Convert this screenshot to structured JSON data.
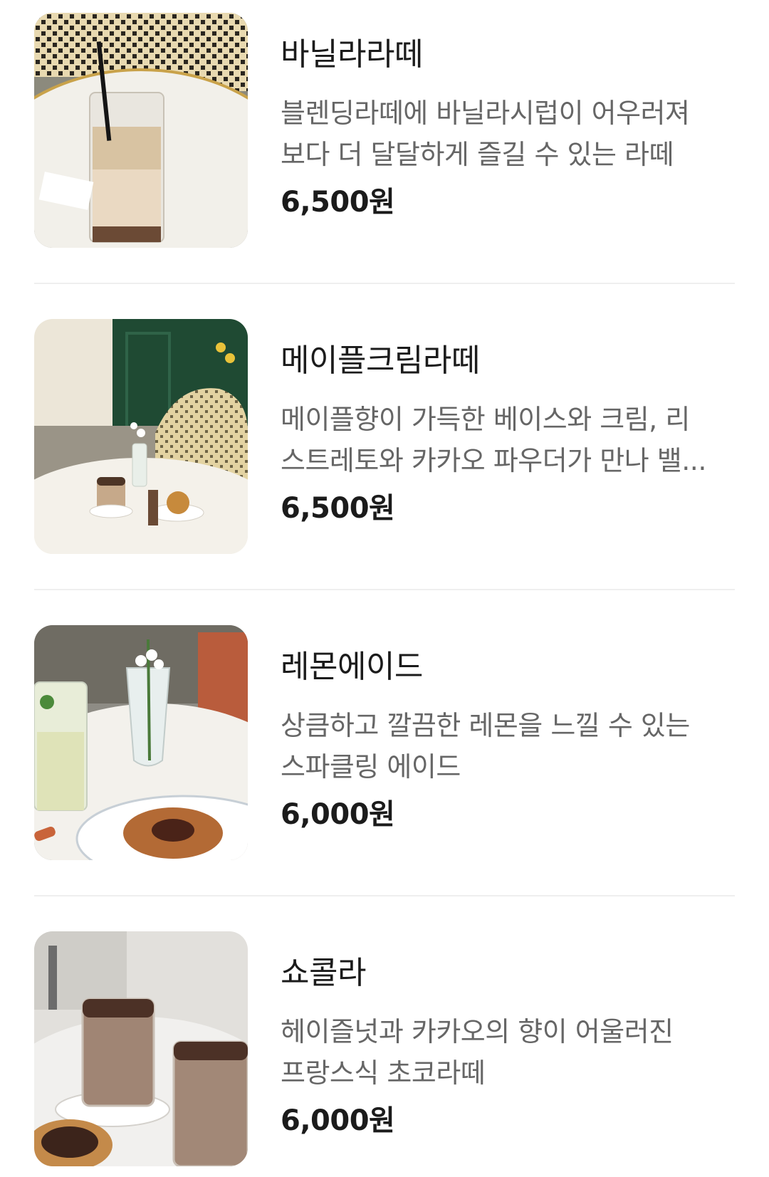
{
  "menu": {
    "items": [
      {
        "name": "바닐라라떼",
        "description_lines": [
          "블렌딩라떼에 바닐라시럽이 어우러져",
          "보다 더 달달하게 즐길 수 있는 라떼"
        ],
        "price": "6,500원",
        "photo": "iced-vanilla-latte-photo"
      },
      {
        "name": "메이플크림라떼",
        "description_lines": [
          "메이플향이 가득한 베이스와 크림, 리",
          "스트레토와 카카오 파우더가 만나 밸..."
        ],
        "price": "6,500원",
        "photo": "cafe-table-dessert-photo"
      },
      {
        "name": "레몬에이드",
        "description_lines": [
          "상큼하고 깔끔한 레몬을 느낄 수 있는",
          "스파클링 에이드"
        ],
        "price": "6,000원",
        "photo": "lemonade-and-pastry-photo"
      },
      {
        "name": "쇼콜라",
        "description_lines": [
          "헤이즐넛과 카카오의 향이 어울러진",
          "프랑스식 초코라떼"
        ],
        "price": "6,000원",
        "photo": "chocolate-latte-photo"
      }
    ]
  },
  "colors": {
    "title": "#1b1b1b",
    "description": "#666666",
    "divider": "#efefef"
  }
}
